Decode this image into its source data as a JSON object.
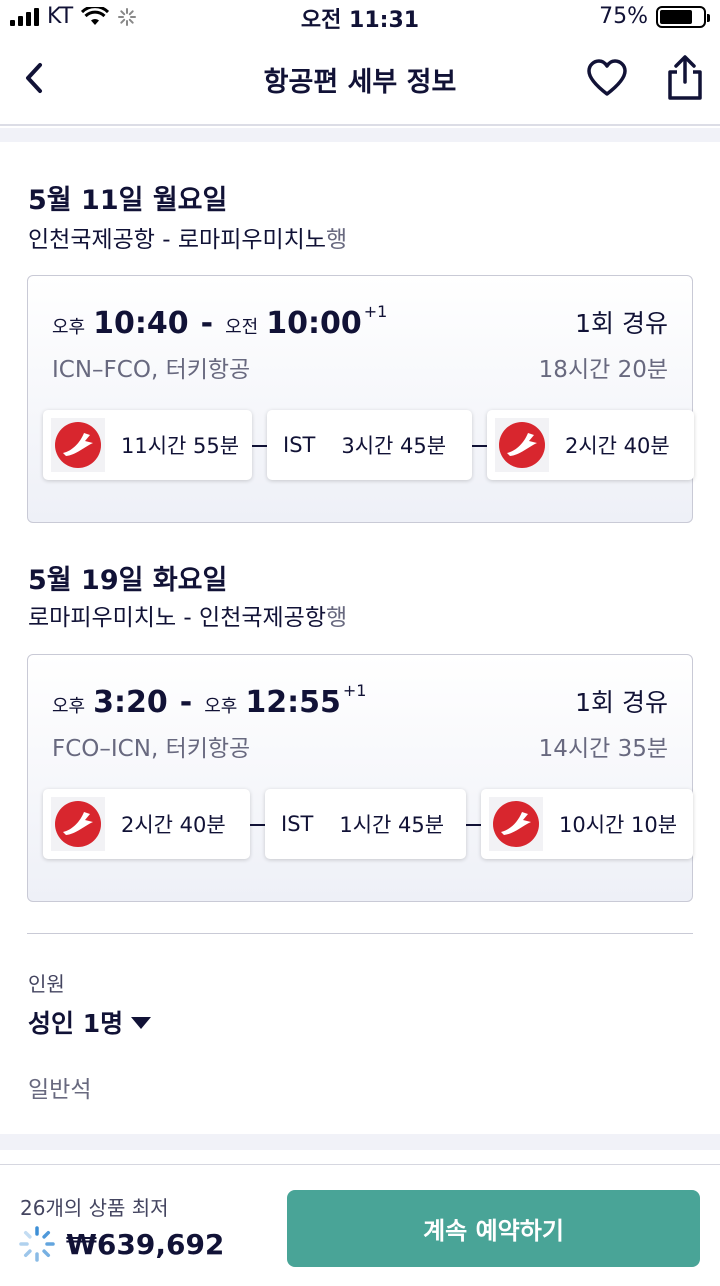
{
  "status_bar": {
    "carrier": "KT",
    "time": "오전 11:31",
    "battery_percent": "75%",
    "battery_level": 0.75
  },
  "header": {
    "title": "항공편 세부 정보",
    "back_icon": "chevron-left-icon",
    "favorite_icon": "heart-icon",
    "share_icon": "share-icon"
  },
  "legs": [
    {
      "date": "5월 11일 월요일",
      "route": "인천국제공항 - 로마피우미치노",
      "route_suffix": "행",
      "depart_ampm": "오후",
      "depart_time": "10:40",
      "dash": "-",
      "arrive_ampm": "오전",
      "arrive_time": "10:00",
      "day_offset": "+1",
      "stops": "1회 경유",
      "airports_airline": "ICN–FCO, 터키항공",
      "total_duration": "18시간 20분",
      "segments": [
        {
          "type": "flight",
          "duration": "11시간 55분"
        },
        {
          "type": "layover",
          "airport": "IST",
          "duration": "3시간 45분"
        },
        {
          "type": "flight",
          "duration": "2시간 40분"
        }
      ]
    },
    {
      "date": "5월 19일 화요일",
      "route": "로마피우미치노 - 인천국제공항",
      "route_suffix": "행",
      "depart_ampm": "오후",
      "depart_time": "3:20",
      "dash": "-",
      "arrive_ampm": "오후",
      "arrive_time": "12:55",
      "day_offset": "+1",
      "stops": "1회 경유",
      "airports_airline": "FCO–ICN, 터키항공",
      "total_duration": "14시간 35분",
      "segments": [
        {
          "type": "flight",
          "duration": "2시간 40분"
        },
        {
          "type": "layover",
          "airport": "IST",
          "duration": "1시간 45분"
        },
        {
          "type": "flight",
          "duration": "10시간 10분"
        }
      ]
    }
  ],
  "passengers": {
    "label": "인원",
    "value": "성인 1명",
    "cabin": "일반석"
  },
  "footer": {
    "offers_text": "26개의 상품 최저",
    "price": "₩639,692",
    "cta_label": "계속 예약하기"
  },
  "colors": {
    "text_primary": "#111236",
    "text_secondary": "#68697f",
    "accent_button": "#49a497",
    "airline_red": "#d8262e"
  }
}
